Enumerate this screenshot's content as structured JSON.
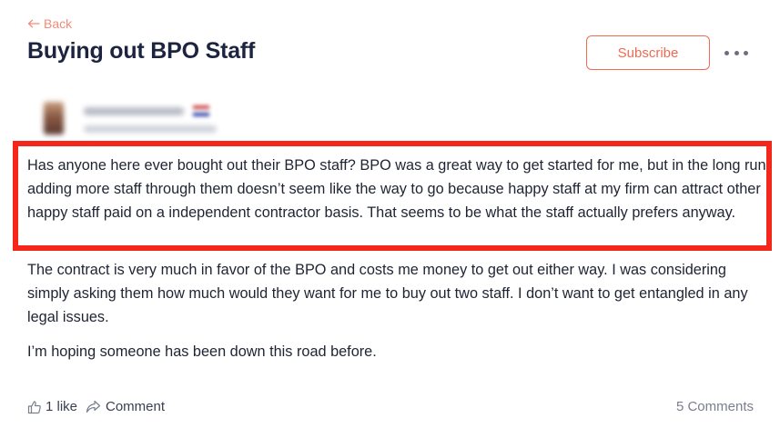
{
  "nav": {
    "back_label": "Back"
  },
  "post": {
    "title": "Buying out BPO Staff",
    "subscribe_label": "Subscribe",
    "paragraphs": [
      "Has anyone here ever bought out their BPO staff? BPO was a great way to get started for me, but in the long run adding more staff through them doesn’t seem like the way to go because happy staff at my firm can attract other happy staff paid on a independent contractor basis. That seems to be what the staff actually prefers anyway.",
      "The contract is very much in favor of the BPO and costs me money to get out either way. I was considering simply asking them how much would they want for me to buy out two staff. I don’t want to get entangled in any legal issues.",
      "I’m hoping someone has been down this road before."
    ]
  },
  "footer": {
    "like_label": "1 like",
    "comment_label": "Comment",
    "comments_count": "5 Comments"
  },
  "icons": {
    "back": "arrow-left-icon",
    "more": "ellipsis-icon",
    "like": "thumbs-up-icon",
    "comment": "share-arrow-icon"
  },
  "colors": {
    "accent": "#f06a52",
    "highlight_border": "#f5261a",
    "title": "#1c2440"
  }
}
